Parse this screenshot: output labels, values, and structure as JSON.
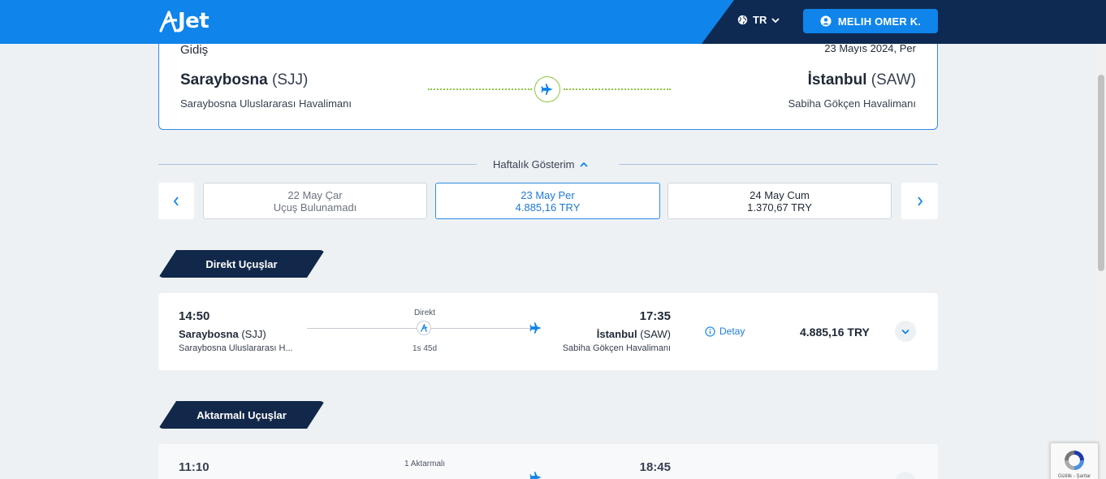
{
  "header": {
    "logo_text": "Jet",
    "language": "TR",
    "user_name": "MELIH OMER K."
  },
  "route": {
    "direction_label": "Gidiş",
    "date": "23 Mayıs 2024, Per",
    "origin_city": "Saraybosna",
    "origin_code": "(SJJ)",
    "origin_airport": "Saraybosna Uluslararası Havalimanı",
    "dest_city": "İstanbul",
    "dest_code": "(SAW)",
    "dest_airport": "Sabiha Gökçen Havalimanı"
  },
  "weekly": {
    "label": "Haftalık Gösterim",
    "days": [
      {
        "date": "22 May Çar",
        "info": "Uçuş Bulunamadı"
      },
      {
        "date": "23 May Per",
        "info": "4.885,16 TRY"
      },
      {
        "date": "24 May Cum",
        "info": "1.370,67 TRY"
      }
    ]
  },
  "sections": {
    "direct": "Direkt Uçuşlar",
    "connecting": "Aktarmalı Uçuşlar"
  },
  "flights": [
    {
      "dep_time": "14:50",
      "dep_city": "Saraybosna",
      "dep_code": "(SJJ)",
      "dep_airport": "Saraybosna Uluslararası H...",
      "stop_type": "Direkt",
      "duration": "1s 45d",
      "arr_time": "17:35",
      "arr_city": "İstanbul",
      "arr_code": "(SAW)",
      "arr_airport": "Sabiha Gökçen Havalimanı",
      "detail_label": "Detay",
      "price": "4.885,16 TRY"
    },
    {
      "dep_time": "11:10",
      "stop_type": "1 Aktarmalı",
      "arr_time": "18:45"
    }
  ],
  "recaptcha": {
    "text": "Gizlilik - Şartlar"
  },
  "colors": {
    "primary": "#0f84ea",
    "navy": "#0e2a52",
    "green_dots": "#8dc63f"
  }
}
